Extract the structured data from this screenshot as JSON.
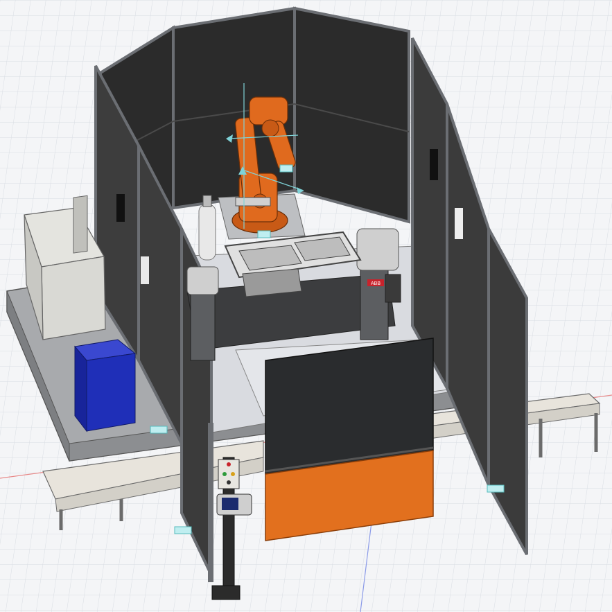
{
  "viewport": {
    "background": "#f4f5f7",
    "grid_color": "#d9dde3",
    "axis_x_color": "#e88a8a",
    "axis_y_color": "#8a9ae8"
  },
  "colors": {
    "robot_orange": "#e06a1e",
    "fence_panel": "#2b2b2b",
    "fence_frame": "#6b6e73",
    "floor_plate": "#d9dbe0",
    "platform": "#9a9c9f",
    "conveyor": "#e8e4dc",
    "door_black": "#2a2c2e",
    "door_orange": "#e2701e",
    "controller_cabinet": "#d9d9d4",
    "blue_cabinet": "#1f2fb8",
    "gas_cylinder": "#e8e8e8",
    "positioner": "#cfcfcf",
    "abb_red": "#c8232c",
    "gizmo_teal": "#7fd3d8"
  },
  "components": {
    "robot": "robot-arm",
    "robot_logo": "ABB",
    "positioner_logo": "ABB",
    "controller": "robot-controller",
    "cabinet": "blue-cabinet",
    "cylinder": "gas-cylinder",
    "fixture": "weld-fixture-frame",
    "positioner": "two-axis-positioner",
    "conveyor_left": "infeed-conveyor",
    "conveyor_right": "outfeed-conveyor",
    "door": "roll-up-door",
    "pushbutton_station": "operator-station",
    "teach_pendant": "flexpendant"
  },
  "icons": {
    "gizmo": "move-gizmo-icon",
    "marker": "joint-marker-icon"
  }
}
